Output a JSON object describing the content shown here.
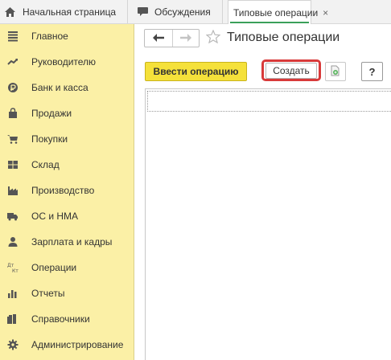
{
  "tabs": {
    "home": "Начальная страница",
    "discussions": "Обсуждения",
    "active": "Типовые операции",
    "close_glyph": "×"
  },
  "sidebar": {
    "items": [
      {
        "label": "Главное",
        "icon": "menu-icon"
      },
      {
        "label": "Руководителю",
        "icon": "trend-icon"
      },
      {
        "label": "Банк и касса",
        "icon": "coin-icon"
      },
      {
        "label": "Продажи",
        "icon": "bag-icon"
      },
      {
        "label": "Покупки",
        "icon": "cart-icon"
      },
      {
        "label": "Склад",
        "icon": "warehouse-icon"
      },
      {
        "label": "Производство",
        "icon": "factory-icon"
      },
      {
        "label": "ОС и НМА",
        "icon": "truck-icon"
      },
      {
        "label": "Зарплата и кадры",
        "icon": "person-icon"
      },
      {
        "label": "Операции",
        "icon": "debit-credit-icon"
      },
      {
        "label": "Отчеты",
        "icon": "bar-chart-icon"
      },
      {
        "label": "Справочники",
        "icon": "books-icon"
      },
      {
        "label": "Администрирование",
        "icon": "gear-icon"
      }
    ]
  },
  "page": {
    "title": "Типовые операции"
  },
  "toolbar": {
    "enter_operation": "Ввести операцию",
    "create": "Создать",
    "help": "?"
  },
  "colors": {
    "sidebar_bg": "#fbf0a6",
    "primary_button": "#f5e13a",
    "highlight": "#d83a3a",
    "active_tab_underline": "#3aa05a"
  }
}
